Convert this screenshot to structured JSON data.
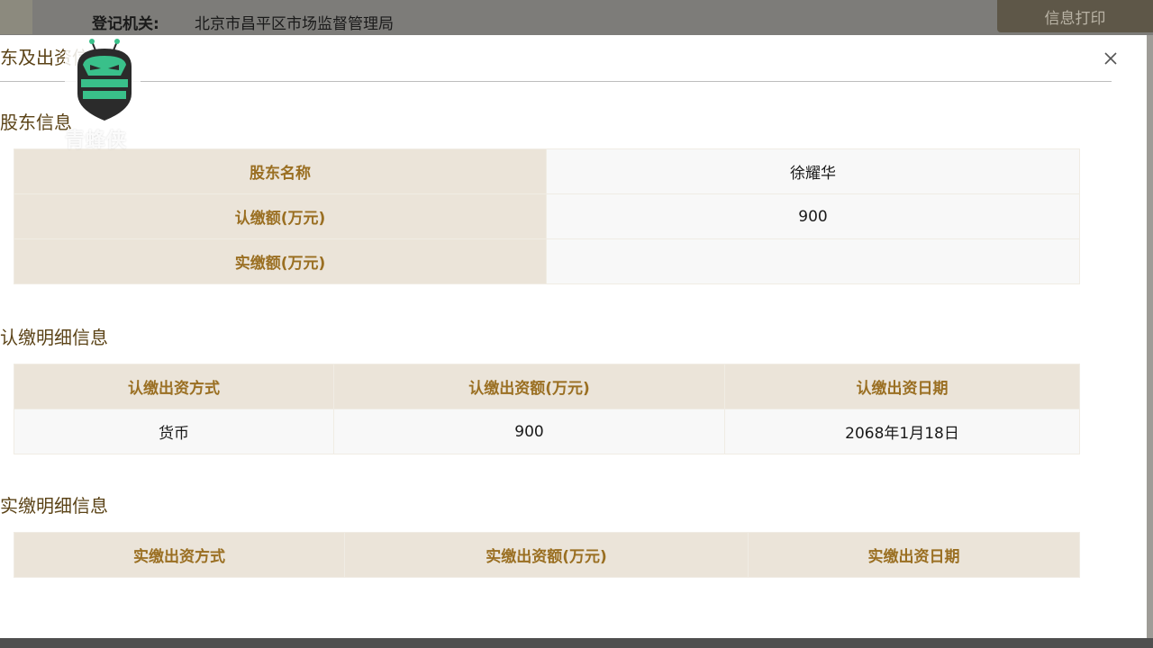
{
  "background": {
    "reg_label": "登记机关:",
    "reg_value": "北京市昌平区市场监督管理局",
    "print_button": "信息打印"
  },
  "modal": {
    "title": "东及出资信息",
    "close_icon": "close-icon"
  },
  "watermark": {
    "text": "青蜂侠",
    "logo_icon": "bee-logo-icon"
  },
  "shareholder_section": {
    "title": "股东信息",
    "rows": [
      {
        "label": "股东名称",
        "value": "徐耀华"
      },
      {
        "label": "认缴额(万元)",
        "value": "900"
      },
      {
        "label": "实缴额(万元)",
        "value": ""
      }
    ]
  },
  "subscribed_section": {
    "title": "认缴明细信息",
    "headers": [
      "认缴出资方式",
      "认缴出资额(万元)",
      "认缴出资日期"
    ],
    "rows": [
      [
        "货币",
        "900",
        "2068年1月18日"
      ]
    ]
  },
  "paid_section": {
    "title": "实缴明细信息",
    "headers": [
      "实缴出资方式",
      "实缴出资额(万元)",
      "实缴出资日期"
    ]
  },
  "colors": {
    "label_bg": "#ebe4d9",
    "label_text": "#9a6f22",
    "title_text": "#5b4317",
    "value_bg": "#f8f8f8"
  }
}
